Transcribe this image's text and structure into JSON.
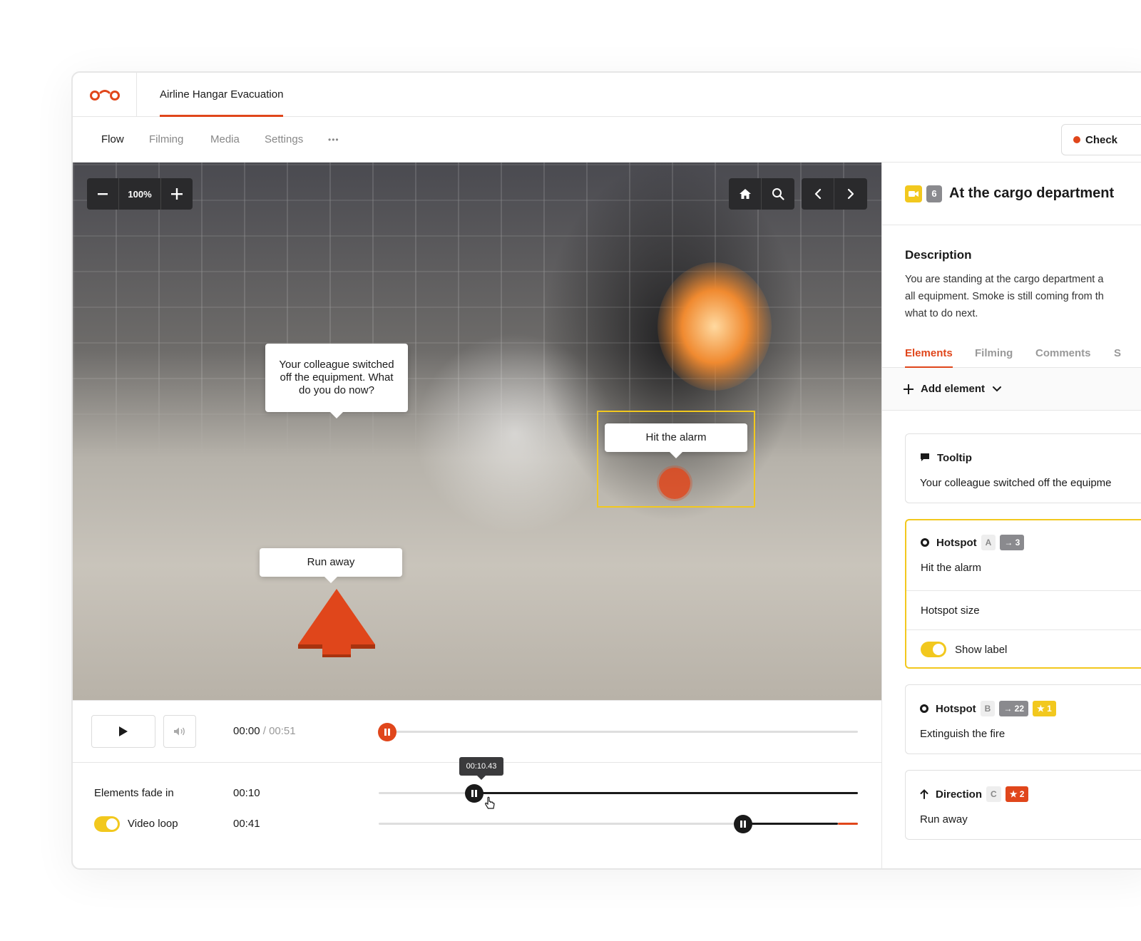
{
  "project": {
    "tab_label": "Airline Hangar Evacuation"
  },
  "subnav": {
    "items": [
      "Flow",
      "Filming",
      "Media",
      "Settings"
    ],
    "more": "•••",
    "check_label": "Check"
  },
  "viewer": {
    "zoom": "100%",
    "bubbles": {
      "question": "Your colleague switched off the equipment. What do you do now?",
      "hotspot_label": "Hit the alarm",
      "direction_label": "Run away"
    }
  },
  "timeline": {
    "current_time": "00:00",
    "separator": " / ",
    "duration": "00:51",
    "scrubber_tooltip": "00:10.43",
    "fade_label": "Elements fade in",
    "fade_time": "00:10",
    "fade_progress": 0.2,
    "loop_label": "Video loop",
    "loop_time": "00:41",
    "loop_progress": 0.76,
    "playback_progress": 0.0
  },
  "panel": {
    "scene_number": "6",
    "title": "At the cargo department",
    "description_heading": "Description",
    "description_lines": [
      "You are standing at the cargo department a",
      "all equipment. Smoke is still coming from th",
      "what to do next."
    ],
    "tabs": [
      "Elements",
      "Filming",
      "Comments",
      "S"
    ],
    "add_element": "Add element",
    "elements": [
      {
        "type": "Tooltip",
        "text": "Your colleague switched off the equipme"
      },
      {
        "type": "Hotspot",
        "letter": "A",
        "goto": "3",
        "text": "Hit the alarm",
        "size_label": "Hotspot size",
        "show_label": "Show label"
      },
      {
        "type": "Hotspot",
        "letter": "B",
        "goto": "22",
        "stars": "1",
        "text": "Extinguish the fire"
      },
      {
        "type": "Direction",
        "letter": "C",
        "stars": "2",
        "text": "Run away"
      }
    ]
  },
  "colors": {
    "accent": "#e0461b",
    "highlight": "#f2c81e",
    "dark": "#2a2a2c"
  }
}
